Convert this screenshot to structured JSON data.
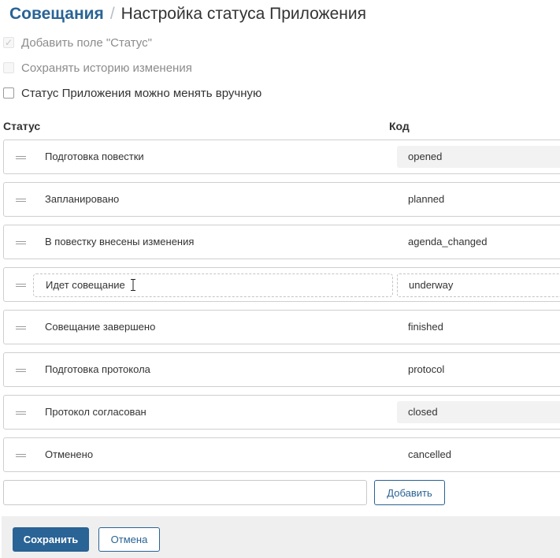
{
  "breadcrumb": {
    "parent": "Совещания",
    "separator": "/",
    "current": "Настройка статуса Приложения"
  },
  "options": [
    {
      "label": "Добавить поле \"Статус\"",
      "checked": true,
      "disabled": true
    },
    {
      "label": "Сохранять историю изменения",
      "checked": false,
      "disabled": true
    },
    {
      "label": "Статус Приложения можно менять вручную",
      "checked": false,
      "disabled": false
    }
  ],
  "columns": {
    "status": "Статус",
    "code": "Код"
  },
  "statuses": [
    {
      "name": "Подготовка повестки",
      "code": "opened",
      "code_shaded": true
    },
    {
      "name": "Запланировано",
      "code": "planned",
      "code_shaded": false
    },
    {
      "name": "В повестку внесены изменения",
      "code": "agenda_changed",
      "code_shaded": false
    },
    {
      "name": "Идет совещание",
      "code": "underway",
      "code_shaded": false,
      "editing": true
    },
    {
      "name": "Совещание завершено",
      "code": "finished",
      "code_shaded": false
    },
    {
      "name": "Подготовка протокола",
      "code": "protocol",
      "code_shaded": false
    },
    {
      "name": "Протокол согласован",
      "code": "closed",
      "code_shaded": true
    },
    {
      "name": "Отменено",
      "code": "cancelled",
      "code_shaded": false
    }
  ],
  "new_status": {
    "value": "",
    "add_label": "Добавить"
  },
  "footer": {
    "save_label": "Сохранить",
    "cancel_label": "Отмена"
  },
  "colors": {
    "accent": "#2a6395",
    "border": "#cfcfcf",
    "footer_bg": "#efefef"
  }
}
